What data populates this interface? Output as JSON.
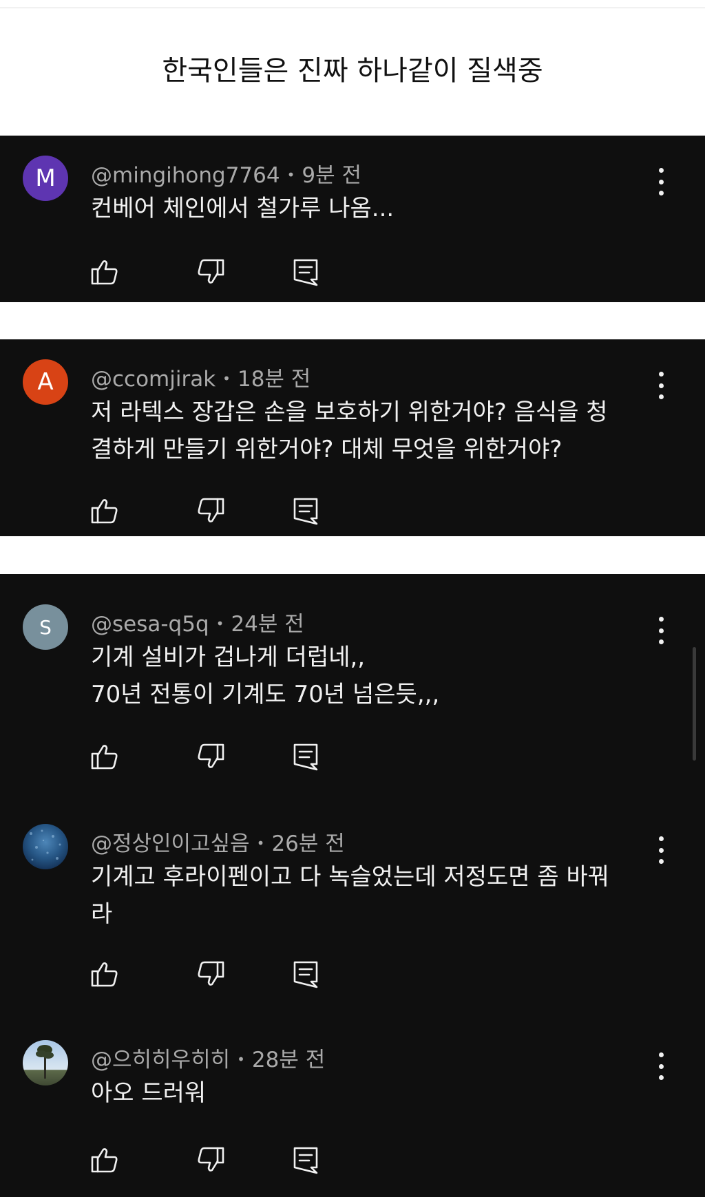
{
  "headline": "한국인들은 진짜 하나같이 질색중",
  "comments": [
    {
      "avatar_letter": "M",
      "avatar_color": "#5e35b1",
      "handle": "@mingihong7764",
      "time": "9분 전",
      "text": "컨베어 체인에서 철가루 나옴..."
    },
    {
      "avatar_letter": "A",
      "avatar_color": "#d84315",
      "handle": "@ccomjirak",
      "time": "18분 전",
      "text": "저 라텍스 장갑은 손을 보호하기 위한거야? 음식을 청\n결하게 만들기 위한거야? 대체 무엇을 위한거야?"
    },
    {
      "avatar_letter": "S",
      "avatar_color": "#78909c",
      "handle": "@sesa-q5q",
      "time": "24분 전",
      "text": "기계 설비가 겁나게 더럽네,,\n70년 전통이 기계도 70년 넘은듯,,,"
    },
    {
      "avatar_letter": "",
      "avatar_color": "#2a5a8a",
      "handle": "@정상인이고싶음",
      "time": "26분 전",
      "text": "기계고 후라이펜이고 다 녹슬었는데 저정도면 좀 바꿔\n라"
    },
    {
      "avatar_letter": "",
      "avatar_color": "#6e8fb0",
      "handle": "@으히히우히히",
      "time": "28분 전",
      "text": "아오 드러워"
    }
  ],
  "icons": {
    "like": "thumbs-up-icon",
    "dislike": "thumbs-down-icon",
    "reply": "reply-comment-icon",
    "more": "more-vertical-icon"
  },
  "colors": {
    "card_bg": "#0f0f0f",
    "meta_text": "#aaaaaa",
    "body_text": "#f1f1f1"
  }
}
